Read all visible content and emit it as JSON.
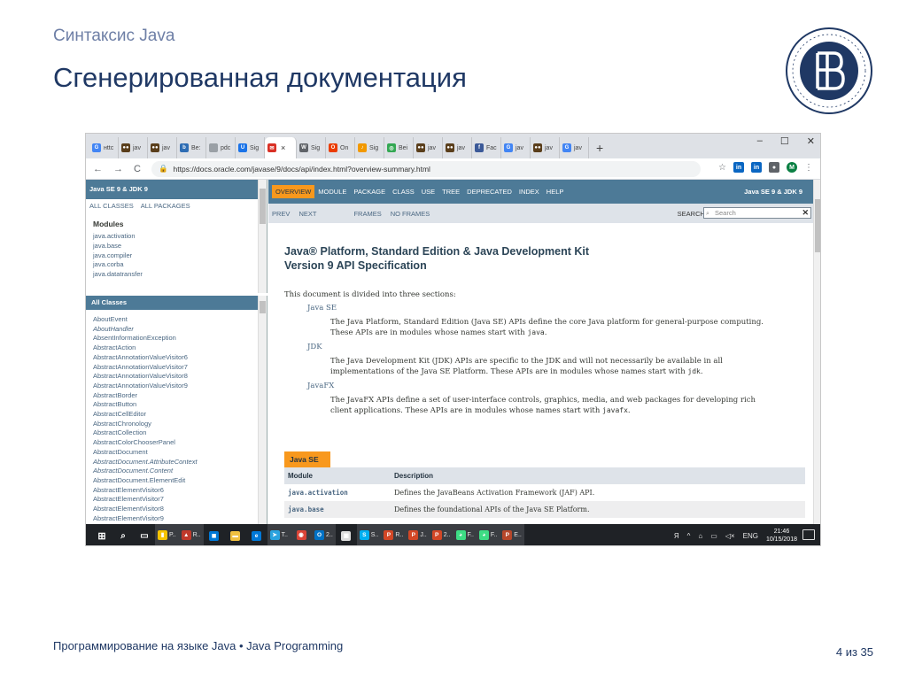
{
  "slide": {
    "subtitle": "Синтаксис Java",
    "title": "Сгенерированная документация",
    "footer": "Программирование на языке Java • Java Programming",
    "page": "4 из 35"
  },
  "colors": {
    "slide_title": "#1f3864",
    "javadoc_header": "#4d7a97",
    "javadoc_accent": "#f8981d",
    "taskbar": "#1f2226"
  },
  "browser": {
    "tabs": [
      {
        "icon": "google-icon",
        "color": "#4285f4",
        "glyph": "G",
        "label": "нttc"
      },
      {
        "icon": "java-icon",
        "color": "#5a3e1b",
        "glyph": "●●",
        "label": "jav"
      },
      {
        "icon": "java-icon",
        "color": "#5a3e1b",
        "glyph": "●●",
        "label": "jav"
      },
      {
        "icon": "bookmark-icon",
        "color": "#2e6db4",
        "glyph": "b",
        "label": "Be:"
      },
      {
        "icon": "blank-icon",
        "color": "#9aa0a6",
        "glyph": "",
        "label": "pdc"
      },
      {
        "icon": "shield-icon",
        "color": "#1a73e8",
        "glyph": "U",
        "label": "Sig"
      },
      {
        "icon": "mail-icon",
        "color": "#d93025",
        "glyph": "✉",
        "label": "Sig"
      },
      {
        "icon": "wikipedia-icon",
        "color": "#5f6368",
        "glyph": "W",
        "label": "Sig"
      },
      {
        "icon": "office-icon",
        "color": "#eb3c00",
        "glyph": "O",
        "label": "On"
      },
      {
        "icon": "paint-icon",
        "color": "#f29900",
        "glyph": "♪",
        "label": "Sig"
      },
      {
        "icon": "browser-icon",
        "color": "#34a853",
        "glyph": "◎",
        "label": "Bei"
      },
      {
        "icon": "java-icon",
        "color": "#5a3e1b",
        "glyph": "●●",
        "label": "jav"
      },
      {
        "icon": "java-icon",
        "color": "#5a3e1b",
        "glyph": "●●",
        "label": "jav"
      },
      {
        "icon": "facebook-icon",
        "color": "#3b5998",
        "glyph": "f",
        "label": "Fac"
      },
      {
        "icon": "google-icon",
        "color": "#4285f4",
        "glyph": "G",
        "label": "jav"
      },
      {
        "icon": "java-icon",
        "color": "#5a3e1b",
        "glyph": "●●",
        "label": "jav"
      },
      {
        "icon": "google-icon",
        "color": "#4285f4",
        "glyph": "G",
        "label": "jav"
      }
    ],
    "active_tab_icon": "mail-icon",
    "close_glyph": "×",
    "new_tab_glyph": "+",
    "window_controls": [
      "–",
      "☐",
      "✕"
    ],
    "url": "https://docs.oracle.com/javase/9/docs/api/index.html?overview-summary.html",
    "extensions": [
      {
        "icon": "linkedin-icon",
        "color": "#0a66c2",
        "glyph": "in"
      },
      {
        "icon": "linkedin-icon",
        "color": "#0a66c2",
        "glyph": "in"
      },
      {
        "icon": "profile-icon",
        "color": "#5f6368",
        "glyph": "●"
      },
      {
        "icon": "avatar-icon",
        "color": "#0b8043",
        "glyph": "M"
      }
    ]
  },
  "left_top": {
    "header": "Java SE 9 & JDK 9",
    "links": [
      "ALL CLASSES",
      "ALL PACKAGES"
    ],
    "section": "Modules",
    "modules": [
      "java.activation",
      "java.base",
      "java.compiler",
      "java.corba",
      "java.datatransfer"
    ]
  },
  "left_bottom": {
    "header": "All Classes",
    "classes": [
      {
        "name": "AboutEvent",
        "italic": false
      },
      {
        "name": "AboutHandler",
        "italic": true
      },
      {
        "name": "AbsentInformationException",
        "italic": false
      },
      {
        "name": "AbstractAction",
        "italic": false
      },
      {
        "name": "AbstractAnnotationValueVisitor6",
        "italic": false
      },
      {
        "name": "AbstractAnnotationValueVisitor7",
        "italic": false
      },
      {
        "name": "AbstractAnnotationValueVisitor8",
        "italic": false
      },
      {
        "name": "AbstractAnnotationValueVisitor9",
        "italic": false
      },
      {
        "name": "AbstractBorder",
        "italic": false
      },
      {
        "name": "AbstractButton",
        "italic": false
      },
      {
        "name": "AbstractCellEditor",
        "italic": false
      },
      {
        "name": "AbstractChronology",
        "italic": false
      },
      {
        "name": "AbstractCollection",
        "italic": false
      },
      {
        "name": "AbstractColorChooserPanel",
        "italic": false
      },
      {
        "name": "AbstractDocument",
        "italic": false
      },
      {
        "name": "AbstractDocument.AttributeContext",
        "italic": true
      },
      {
        "name": "AbstractDocument.Content",
        "italic": true
      },
      {
        "name": "AbstractDocument.ElementEdit",
        "italic": false
      },
      {
        "name": "AbstractElementVisitor6",
        "italic": false
      },
      {
        "name": "AbstractElementVisitor7",
        "italic": false
      },
      {
        "name": "AbstractElementVisitor8",
        "italic": false
      },
      {
        "name": "AbstractElementVisitor9",
        "italic": false
      }
    ]
  },
  "main": {
    "nav": [
      "OVERVIEW",
      "MODULE",
      "PACKAGE",
      "CLASS",
      "USE",
      "TREE",
      "DEPRECATED",
      "INDEX",
      "HELP"
    ],
    "nav_selected": "OVERVIEW",
    "brand": "Java SE 9 & JDK 9",
    "subnav": [
      "PREV",
      "NEXT",
      "FRAMES",
      "NO FRAMES"
    ],
    "search_label": "SEARCH:",
    "search_placeholder": "Search",
    "title_line1": "Java® Platform, Standard Edition & Java Development Kit",
    "title_line2": "Version 9 API Specification",
    "intro": "This document is divided into three sections:",
    "sections": [
      {
        "name": "Java SE",
        "text": "The Java Platform, Standard Edition (Java SE) APIs define the core Java platform for general-purpose computing. These APIs are in modules whose names start with",
        "code": "java",
        "end": "."
      },
      {
        "name": "JDK",
        "text": "The Java Development Kit (JDK) APIs are specific to the JDK and will not necessarily be available in all implementations of the Java SE Platform. These APIs are in modules whose names start with",
        "code": "jdk",
        "end": "."
      },
      {
        "name": "JavaFX",
        "text": "The JavaFX APIs define a set of user-interface controls, graphics, media, and web packages for developing rich client applications. These APIs are in modules whose names start with",
        "code": "javafx",
        "end": "."
      }
    ],
    "table_caption": "Java SE",
    "table_headers": [
      "Module",
      "Description"
    ],
    "table_rows": [
      [
        "java.activation",
        "Defines the JavaBeans Activation Framework (JAF) API."
      ],
      [
        "java.base",
        "Defines the foundational APIs of the Java SE Platform."
      ]
    ]
  },
  "taskbar": {
    "items": [
      {
        "icon": "windows-start-icon",
        "color": "#ffffff",
        "glyph": "⊞",
        "label": "",
        "open": false
      },
      {
        "icon": "search-icon",
        "color": "#1f2226",
        "glyph": "⌕",
        "label": "",
        "open": false
      },
      {
        "icon": "task-view-icon",
        "color": "#1f2226",
        "glyph": "▭",
        "label": "",
        "open": false
      },
      {
        "icon": "sticky-notes-icon",
        "color": "#f5c400",
        "glyph": "▮",
        "label": "P..",
        "open": true
      },
      {
        "icon": "app-icon",
        "color": "#c0392b",
        "glyph": "▲",
        "label": "R..",
        "open": true
      },
      {
        "icon": "store-icon",
        "color": "#0078d7",
        "glyph": "◼",
        "label": "",
        "open": false
      },
      {
        "icon": "folder-icon",
        "color": "#f0c040",
        "glyph": "▬",
        "label": "",
        "open": false
      },
      {
        "icon": "edge-icon",
        "color": "#0078d7",
        "glyph": "e",
        "label": "",
        "open": false
      },
      {
        "icon": "telegram-icon",
        "color": "#2aa3df",
        "glyph": "➤",
        "label": "T..",
        "open": true
      },
      {
        "icon": "chrome-icon",
        "color": "#db4437",
        "glyph": "◉",
        "label": "",
        "open": true
      },
      {
        "icon": "outlook-icon",
        "color": "#0072c6",
        "glyph": "O",
        "label": "2..",
        "open": true
      },
      {
        "icon": "window-icon",
        "color": "#dddddd",
        "glyph": "▣",
        "label": "",
        "open": false
      },
      {
        "icon": "skype-icon",
        "color": "#00aff0",
        "glyph": "S",
        "label": "S..",
        "open": true
      },
      {
        "icon": "powerpoint-icon",
        "color": "#d24726",
        "glyph": "P",
        "label": "R..",
        "open": true
      },
      {
        "icon": "powerpoint-icon",
        "color": "#d24726",
        "glyph": "P",
        "label": "J..",
        "open": true
      },
      {
        "icon": "powerpoint-icon",
        "color": "#d24726",
        "glyph": "P",
        "label": "2..",
        "open": true
      },
      {
        "icon": "android-icon",
        "color": "#3ddc84",
        "glyph": "◕",
        "label": "F..",
        "open": true
      },
      {
        "icon": "android-icon",
        "color": "#3ddc84",
        "glyph": "◕",
        "label": "F..",
        "open": true
      },
      {
        "icon": "powerpoint-icon",
        "color": "#b7472a",
        "glyph": "P",
        "label": "E..",
        "open": true
      }
    ],
    "tray": [
      "Я",
      "^",
      "⌂",
      "▭",
      "◁×",
      "ENG"
    ],
    "time": "21:46",
    "date": "10/15/2018"
  }
}
